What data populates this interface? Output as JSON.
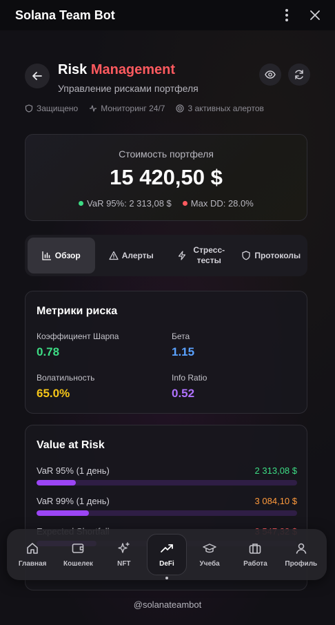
{
  "window": {
    "title": "Solana Team Bot"
  },
  "header": {
    "title_part1": "Risk",
    "title_part2": "Management",
    "subtitle": "Управление рисками портфеля"
  },
  "status": {
    "protected": "Защищено",
    "monitoring": "Мониторинг 24/7",
    "alerts": "3 активных алертов"
  },
  "portfolio": {
    "label": "Стоимость портфеля",
    "value": "15 420,50 $",
    "var": "VaR 95%: 2 313,08 $",
    "maxdd": "Max DD: 28.0%"
  },
  "tabs": [
    {
      "label": "Обзор",
      "active": true
    },
    {
      "label": "Алерты",
      "active": false
    },
    {
      "label": "Стресс-\nтесты",
      "active": false
    },
    {
      "label": "Протоколы",
      "active": false
    }
  ],
  "metrics": {
    "title": "Метрики риска",
    "items": [
      {
        "label": "Коэффициент Шарпа",
        "value": "0.78",
        "color": "#3ddc84"
      },
      {
        "label": "Бета",
        "value": "1.15",
        "color": "#5aa2ff"
      },
      {
        "label": "Волатильность",
        "value": "65.0%",
        "color": "#f5c518"
      },
      {
        "label": "Info Ratio",
        "value": "0.52",
        "color": "#b072ff"
      }
    ]
  },
  "var_card": {
    "title": "Value at Risk",
    "rows": [
      {
        "label": "VaR 95% (1 день)",
        "value": "2 313,08 $",
        "color": "#3ddc84",
        "fill": 0.15
      },
      {
        "label": "VaR 99% (1 день)",
        "value": "3 084,10 $",
        "color": "#ff9a3c",
        "fill": 0.2
      },
      {
        "label": "Expected Shortfall",
        "value": "3 547,32 $",
        "color": "#ff5a5f",
        "fill": 0.23
      }
    ]
  },
  "nav": [
    {
      "label": "Главная",
      "icon": "home-icon"
    },
    {
      "label": "Кошелек",
      "icon": "wallet-icon"
    },
    {
      "label": "NFT",
      "icon": "sparkles-icon"
    },
    {
      "label": "DeFi",
      "icon": "trend-up-icon",
      "active": true
    },
    {
      "label": "Учеба",
      "icon": "graduation-cap-icon"
    },
    {
      "label": "Работа",
      "icon": "briefcase-icon"
    },
    {
      "label": "Профиль",
      "icon": "user-icon"
    }
  ],
  "footer": {
    "handle": "@solanateambot"
  },
  "colors": {
    "accent_red": "#ff5a5f",
    "green": "#3ddc84",
    "purple": "#9b45f4"
  }
}
